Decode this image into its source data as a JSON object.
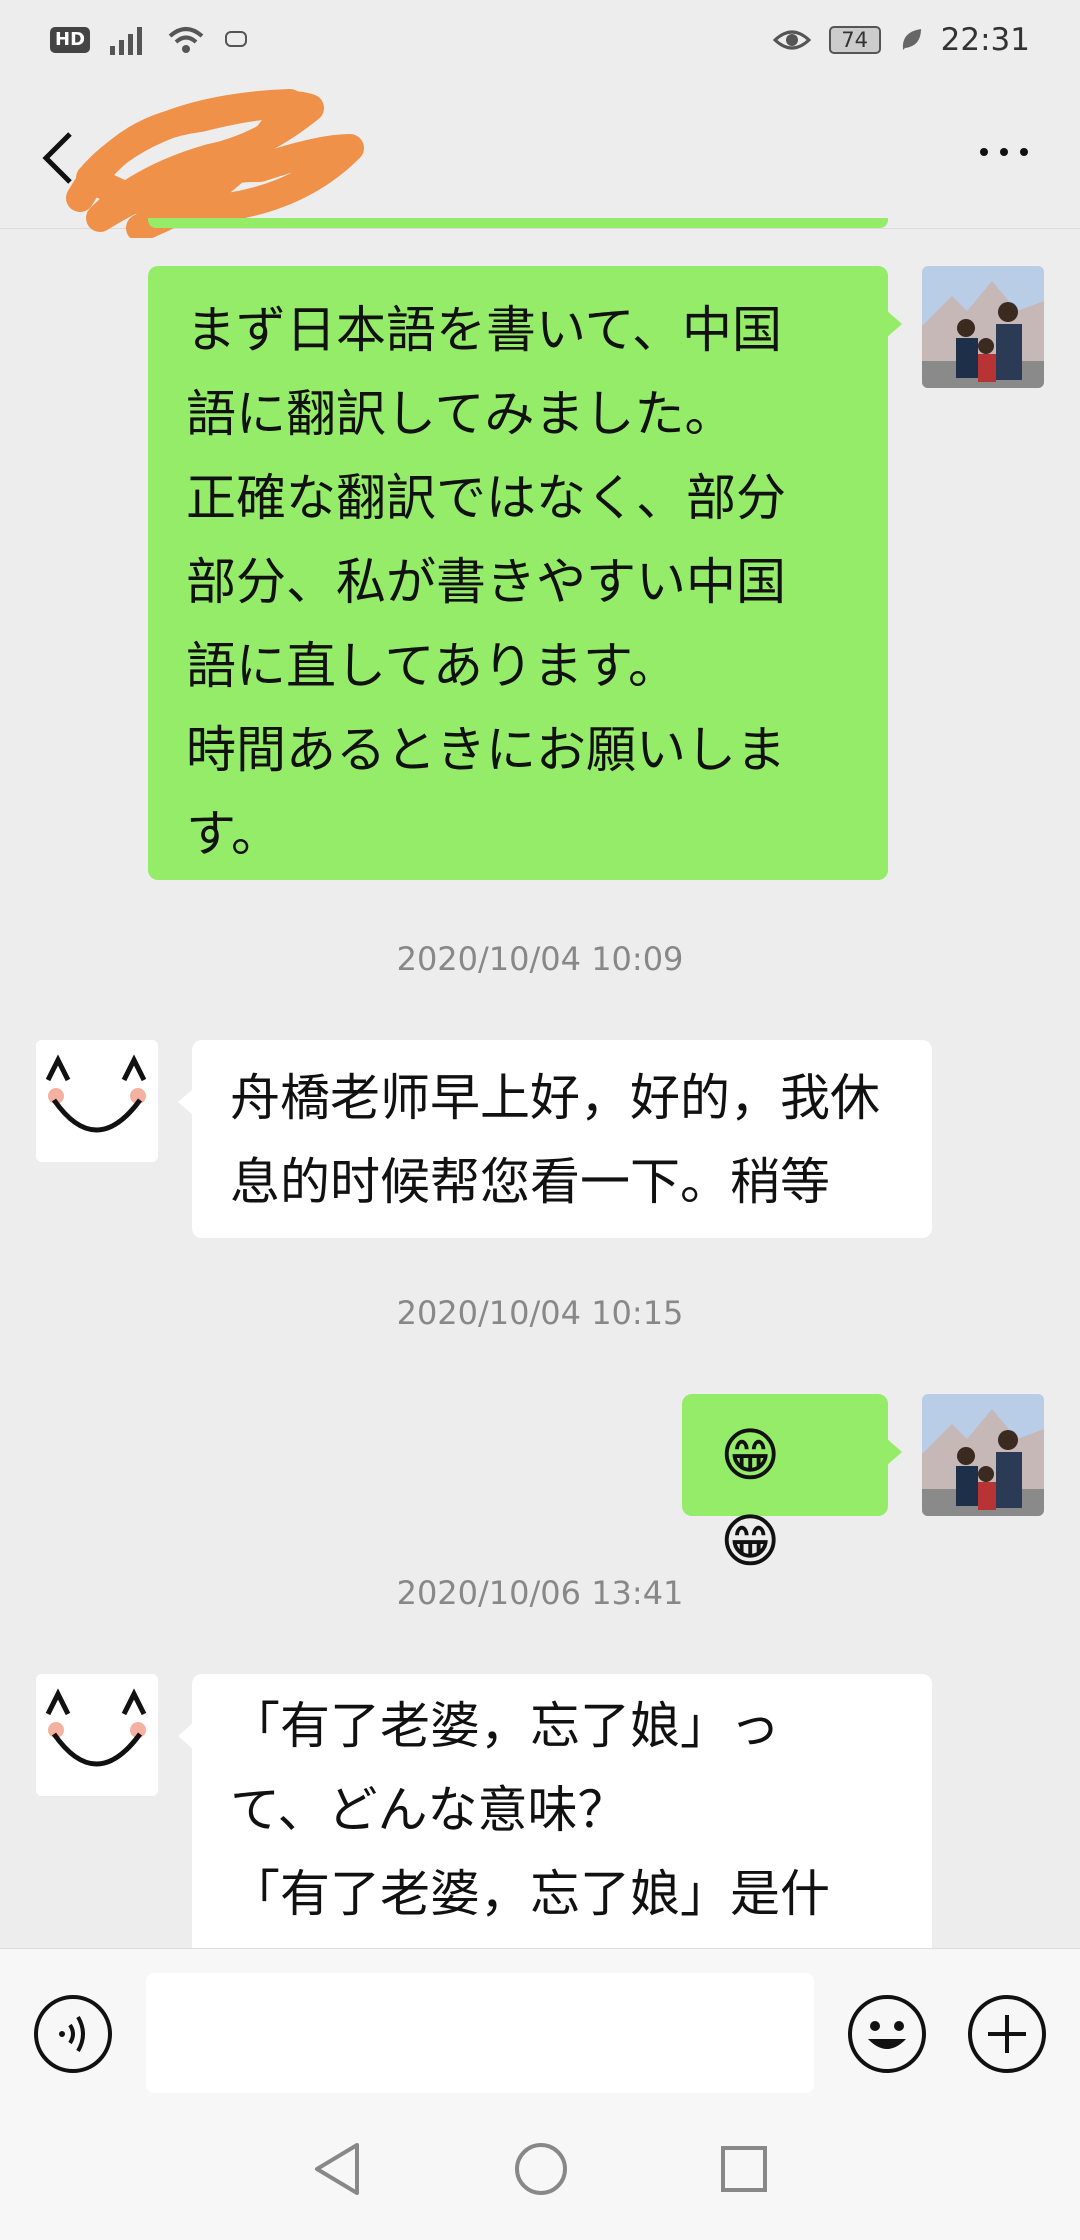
{
  "status_bar": {
    "hd_label": "HD",
    "battery_level": "74",
    "time": "22:31"
  },
  "header": {
    "title_redacted": true,
    "more_icon": "more-dots-icon",
    "back_icon": "back-chevron-icon"
  },
  "messages": [
    {
      "direction": "out",
      "text": "まず日本語を書いて、中国\n語に翻訳してみました。\n正確な翻訳ではなく、部分\n部分、私が書きやすい中国\n語に直してあります。\n時間あるときにお願いしま\nす。"
    },
    {
      "direction": "in",
      "timestamp": "2020/10/04 10:09",
      "text": "舟橋老师早上好，好的，我休\n息的时候帮您看一下。稍等"
    },
    {
      "direction": "out",
      "timestamp": "2020/10/04 10:15",
      "text": "😁😁"
    },
    {
      "direction": "in",
      "timestamp": "2020/10/06 13:41",
      "text": "「有了老婆，忘了娘」っ\nて、どんな意味？\n「有了老婆，忘了娘」是什"
    }
  ],
  "input_bar": {
    "voice_icon": "voice-input-icon",
    "input_value": "",
    "emoji_icon": "emoji-icon",
    "plus_icon": "plus-icon"
  },
  "nav_bar": {
    "back_icon": "nav-back-icon",
    "home_icon": "nav-home-icon",
    "recents_icon": "nav-recents-icon"
  },
  "colors": {
    "outgoing_bubble": "#95ec69",
    "incoming_bubble": "#ffffff",
    "background": "#ededed",
    "redaction_scribble": "#f0914a"
  }
}
